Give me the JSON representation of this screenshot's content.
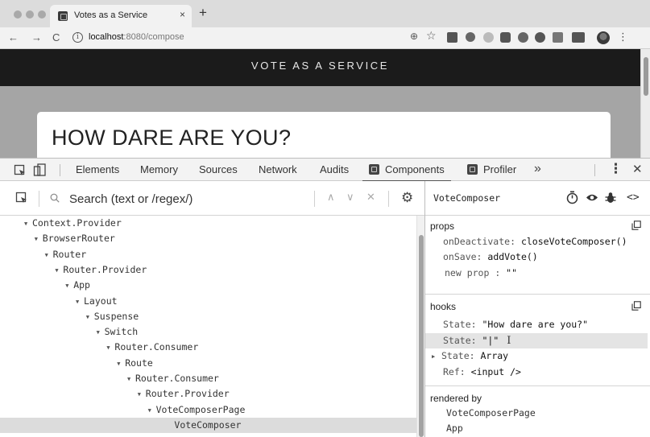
{
  "browser": {
    "tab_title": "Votes as a Service",
    "tab_close": "×",
    "new_tab": "+",
    "url_host": "localhost",
    "url_path": ":8080/compose",
    "nav_back": "←",
    "nav_forward": "→",
    "nav_reload": "C",
    "zoom_icon": "⊕",
    "star_icon": "☆",
    "menu_icon": "⋮"
  },
  "page": {
    "banner_title": "VOTE AS A SERVICE",
    "card_title": "HOW DARE ARE YOU?"
  },
  "devtools": {
    "tabs": [
      "Elements",
      "Memory",
      "Sources",
      "Network",
      "Audits",
      "Components",
      "Profiler"
    ],
    "active_tab": "Components",
    "more": "»",
    "menu": "⋮",
    "close": "✕"
  },
  "tree": {
    "search_placeholder": "Search (text or /regex/)",
    "up": "∧",
    "down": "∨",
    "clear": "✕",
    "nodes": [
      {
        "name": "Context.Provider",
        "depth": 0,
        "expanded": true
      },
      {
        "name": "BrowserRouter",
        "depth": 1,
        "expanded": true
      },
      {
        "name": "Router",
        "depth": 2,
        "expanded": true
      },
      {
        "name": "Router.Provider",
        "depth": 3,
        "expanded": true
      },
      {
        "name": "App",
        "depth": 4,
        "expanded": true
      },
      {
        "name": "Layout",
        "depth": 5,
        "expanded": true
      },
      {
        "name": "Suspense",
        "depth": 6,
        "expanded": true
      },
      {
        "name": "Switch",
        "depth": 7,
        "expanded": true
      },
      {
        "name": "Router.Consumer",
        "depth": 8,
        "expanded": true
      },
      {
        "name": "Route",
        "depth": 9,
        "expanded": true
      },
      {
        "name": "Router.Consumer",
        "depth": 10,
        "expanded": true
      },
      {
        "name": "Router.Provider",
        "depth": 11,
        "expanded": true
      },
      {
        "name": "VoteComposerPage",
        "depth": 12,
        "expanded": true
      },
      {
        "name": "VoteComposer",
        "depth": 13,
        "expanded": false,
        "selected": true
      }
    ]
  },
  "inspector": {
    "component_name": "VoteComposer",
    "props_title": "props",
    "props": [
      {
        "key": "onDeactivate",
        "value": "closeVoteComposer()"
      },
      {
        "key": "onSave",
        "value": "addVote()"
      },
      {
        "key": "new prop",
        "value": "\"\"",
        "separator": " : "
      }
    ],
    "hooks_title": "hooks",
    "hooks": [
      {
        "key": "State",
        "value": "\"How dare are you?\""
      },
      {
        "key": "State",
        "value": "\"|\"",
        "editing": true
      },
      {
        "key": "State",
        "value": "Array",
        "collapsible": true
      },
      {
        "key": "Ref",
        "value": "<input />"
      }
    ],
    "rendered_by_title": "rendered by",
    "rendered_by": [
      "VoteComposerPage",
      "App"
    ]
  }
}
